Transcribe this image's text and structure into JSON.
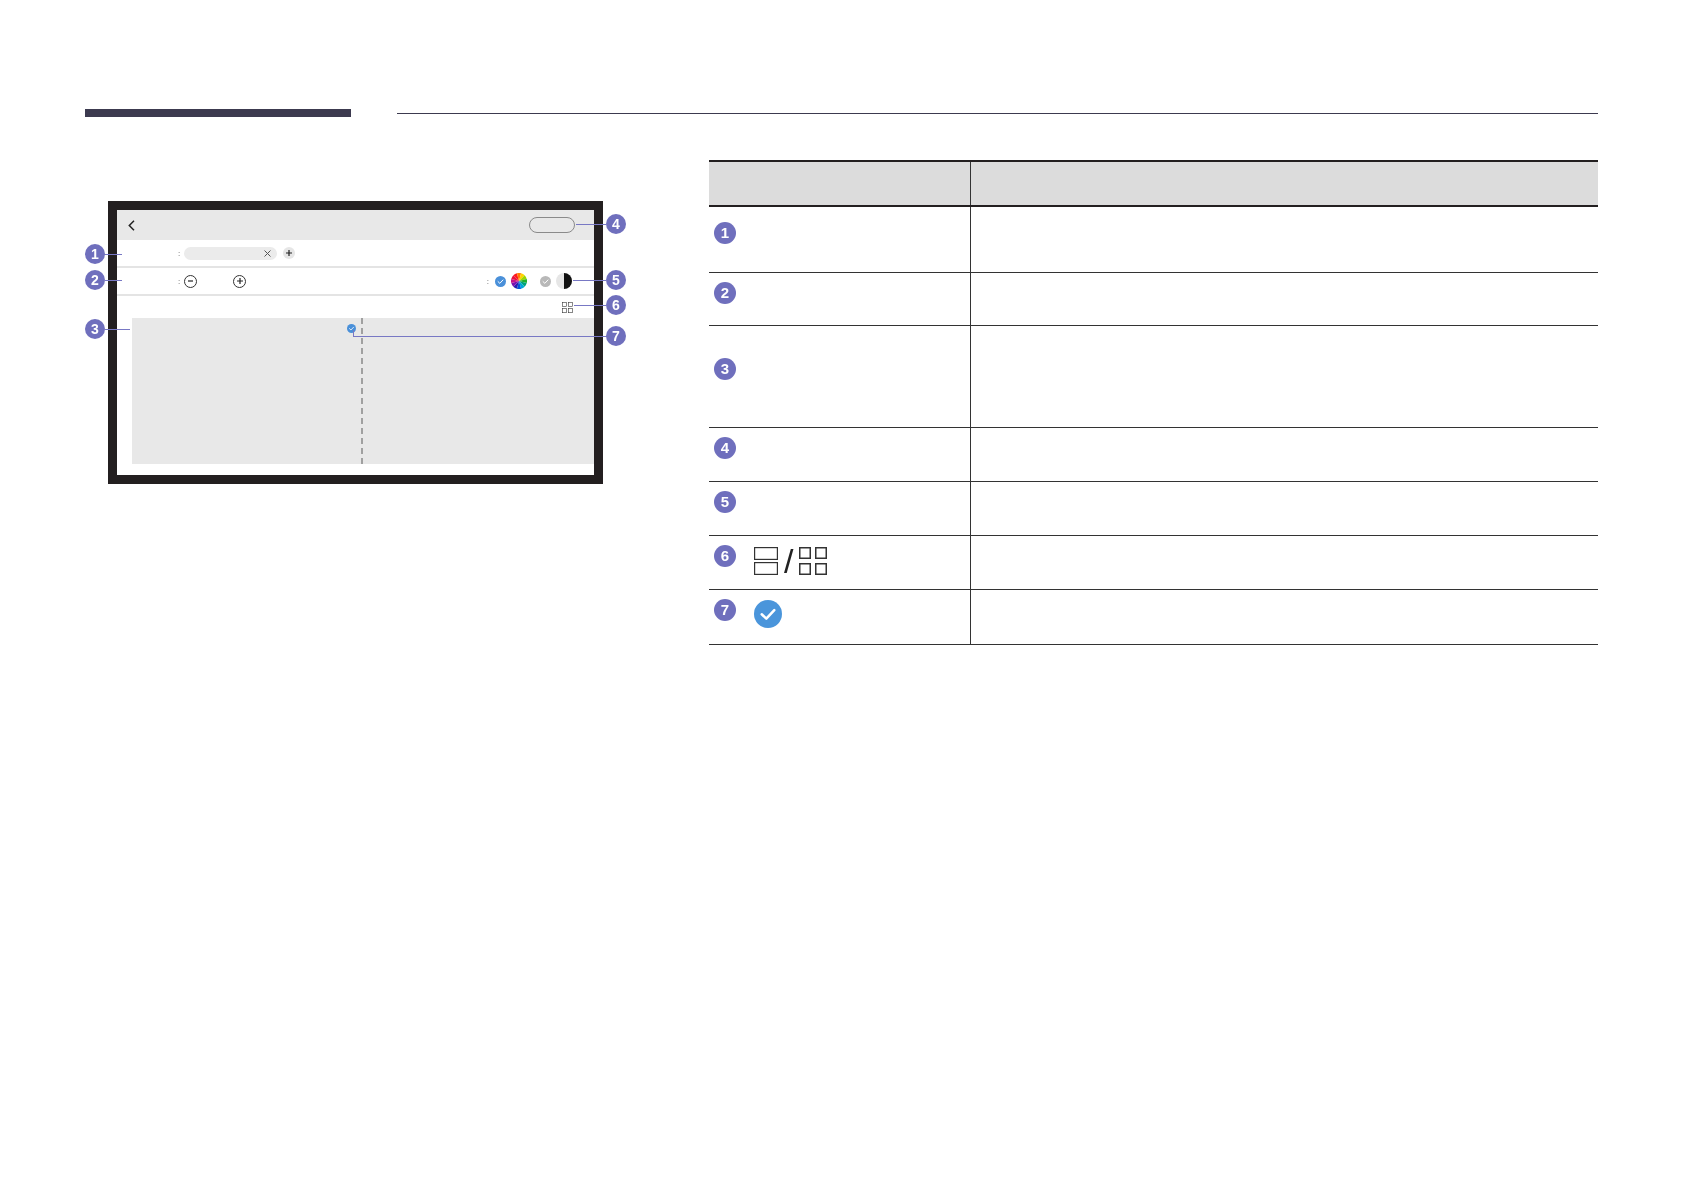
{
  "figure": {
    "callouts": [
      "1",
      "2",
      "3",
      "4",
      "5",
      "6",
      "7"
    ],
    "screen": {
      "tag_row": {
        "separator": ":"
      },
      "control_row": {
        "separator": ":",
        "mode_separator": ":",
        "modes": [
          {
            "kind": "color",
            "selected": true
          },
          {
            "kind": "mono",
            "selected": false
          }
        ]
      },
      "panes": [
        {
          "selected": true
        },
        {
          "selected": false
        }
      ]
    }
  },
  "table": {
    "rows": [
      {
        "number": "1",
        "kind": "plain"
      },
      {
        "number": "2",
        "kind": "plain"
      },
      {
        "number": "3",
        "kind": "plain"
      },
      {
        "number": "4",
        "kind": "plain"
      },
      {
        "number": "5",
        "kind": "plain"
      },
      {
        "number": "6",
        "kind": "layout_icons",
        "separator": "/"
      },
      {
        "number": "7",
        "kind": "check_icon"
      }
    ]
  }
}
